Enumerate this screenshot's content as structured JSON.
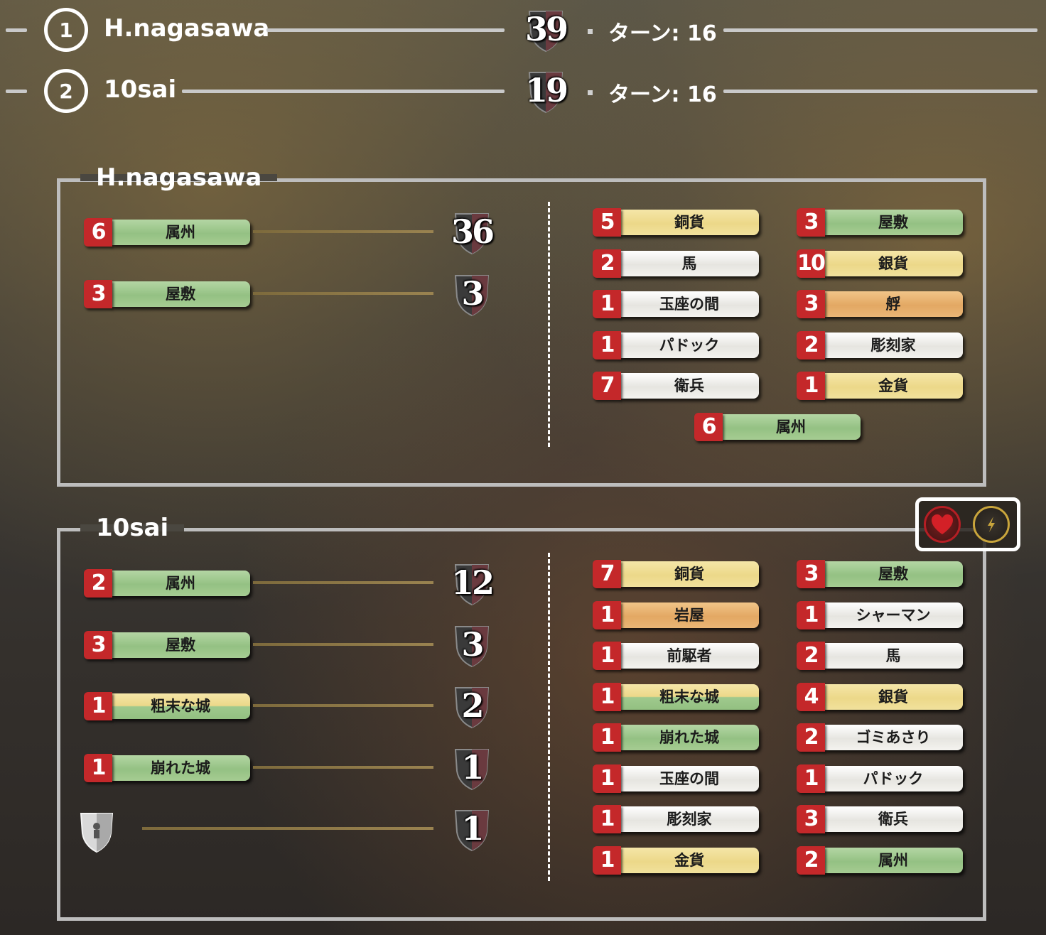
{
  "scoreboard": [
    {
      "rank": "1",
      "name": "H.nagasawa",
      "score": "39",
      "turn": "ターン: 16"
    },
    {
      "rank": "2",
      "name": "10sai",
      "score": "19",
      "turn": "ターン: 16"
    }
  ],
  "players": [
    {
      "title": "H.nagasawa",
      "summary": [
        {
          "count": "6",
          "label": "属州",
          "color": "green",
          "points": "36"
        },
        {
          "count": "3",
          "label": "屋敷",
          "color": "green",
          "points": "3"
        }
      ],
      "cards_left": [
        {
          "count": "5",
          "label": "銅貨",
          "color": "yellow"
        },
        {
          "count": "2",
          "label": "馬",
          "color": "white"
        },
        {
          "count": "1",
          "label": "玉座の間",
          "color": "white"
        },
        {
          "count": "1",
          "label": "パドック",
          "color": "white"
        },
        {
          "count": "7",
          "label": "衛兵",
          "color": "white"
        }
      ],
      "cards_right": [
        {
          "count": "3",
          "label": "屋敷",
          "color": "green"
        },
        {
          "count": "10",
          "label": "銀貨",
          "color": "yellow"
        },
        {
          "count": "3",
          "label": "艀",
          "color": "orange"
        },
        {
          "count": "2",
          "label": "彫刻家",
          "color": "white"
        },
        {
          "count": "1",
          "label": "金貨",
          "color": "yellow"
        }
      ],
      "cards_center": [
        {
          "count": "6",
          "label": "属州",
          "color": "green"
        }
      ]
    },
    {
      "title": "10sai",
      "summary": [
        {
          "count": "2",
          "label": "属州",
          "color": "green",
          "points": "12"
        },
        {
          "count": "3",
          "label": "屋敷",
          "color": "green",
          "points": "3"
        },
        {
          "count": "1",
          "label": "粗末な城",
          "color": "yellowgreen",
          "points": "2"
        },
        {
          "count": "1",
          "label": "崩れた城",
          "color": "green",
          "points": "1"
        },
        {
          "count": "",
          "label": "",
          "color": "token",
          "points": "1"
        }
      ],
      "cards_left": [
        {
          "count": "7",
          "label": "銅貨",
          "color": "yellow"
        },
        {
          "count": "1",
          "label": "岩屋",
          "color": "orange"
        },
        {
          "count": "1",
          "label": "前駆者",
          "color": "white"
        },
        {
          "count": "1",
          "label": "粗末な城",
          "color": "yellowgreen"
        },
        {
          "count": "1",
          "label": "崩れた城",
          "color": "green"
        },
        {
          "count": "1",
          "label": "玉座の間",
          "color": "white"
        },
        {
          "count": "1",
          "label": "彫刻家",
          "color": "white"
        },
        {
          "count": "1",
          "label": "金貨",
          "color": "yellow"
        }
      ],
      "cards_right": [
        {
          "count": "3",
          "label": "屋敷",
          "color": "green"
        },
        {
          "count": "1",
          "label": "シャーマン",
          "color": "white"
        },
        {
          "count": "2",
          "label": "馬",
          "color": "white"
        },
        {
          "count": "4",
          "label": "銀貨",
          "color": "yellow"
        },
        {
          "count": "2",
          "label": "ゴミあさり",
          "color": "white"
        },
        {
          "count": "1",
          "label": "パドック",
          "color": "white"
        },
        {
          "count": "3",
          "label": "衛兵",
          "color": "white"
        },
        {
          "count": "2",
          "label": "属州",
          "color": "green"
        }
      ],
      "cards_center": []
    }
  ],
  "icons": {
    "favorite": "heart-icon",
    "trigger": "lightning-icon"
  },
  "colors": {
    "badge": "#c4282a",
    "border": "#bdbdbd",
    "accent_gold": "#c9a53c",
    "heart": "#d32027"
  }
}
